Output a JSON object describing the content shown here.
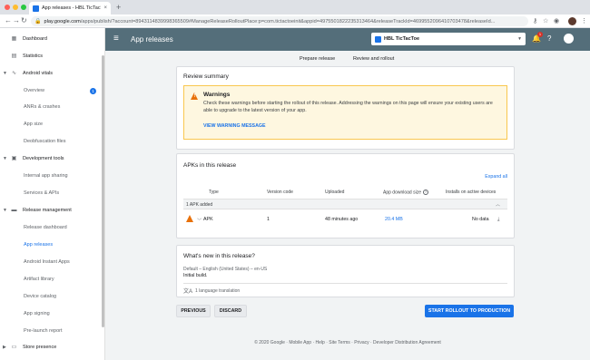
{
  "browser": {
    "tab_title": "App releases - HBL TicTacToe",
    "tab_close": "×",
    "new_tab": "+",
    "url_host": "play.google.com",
    "url_path": "/apps/publish/?account=8943114839998365509#ManageReleaseRolloutPlace:p=com.tictactoeinit&appid=4975501822235313464&releaseTrackId=4699552096410703478&releaseId...",
    "colors": {
      "close": "#ff5f57",
      "minimize": "#febc2e",
      "maximize": "#28c840"
    }
  },
  "sidebar": {
    "items": [
      {
        "label": "Dashboard",
        "icon": "dashboard-icon",
        "level": "top"
      },
      {
        "label": "Statistics",
        "icon": "statistics-icon",
        "level": "top"
      },
      {
        "label": "Android vitals",
        "icon": "vitals-icon",
        "level": "top",
        "expanded": true
      },
      {
        "label": "Overview",
        "level": "sub",
        "badge": "1"
      },
      {
        "label": "ANRs & crashes",
        "level": "sub"
      },
      {
        "label": "App size",
        "level": "sub"
      },
      {
        "label": "Deobfuscation files",
        "level": "sub"
      },
      {
        "label": "Development tools",
        "icon": "devtools-icon",
        "level": "top",
        "expanded": true
      },
      {
        "label": "Internal app sharing",
        "level": "sub"
      },
      {
        "label": "Services & APIs",
        "level": "sub"
      },
      {
        "label": "Release management",
        "icon": "release-icon",
        "level": "top",
        "expanded": true
      },
      {
        "label": "Release dashboard",
        "level": "sub"
      },
      {
        "label": "App releases",
        "level": "sub",
        "active": true
      },
      {
        "label": "Android Instant Apps",
        "level": "sub"
      },
      {
        "label": "Artifact library",
        "level": "sub"
      },
      {
        "label": "Device catalog",
        "level": "sub"
      },
      {
        "label": "App signing",
        "level": "sub"
      },
      {
        "label": "Pre-launch report",
        "level": "sub"
      },
      {
        "label": "Store presence",
        "icon": "store-icon",
        "level": "top",
        "expanded": false
      }
    ]
  },
  "header": {
    "title": "App releases",
    "app_name": "HBL TicTacToe",
    "notification_count": "1",
    "accent": "#546e7a"
  },
  "steps": {
    "prepare": "Prepare release",
    "review": "Review and rollout"
  },
  "review_summary": {
    "title": "Review summary",
    "warning_heading": "Warnings",
    "warning_text": "Check these warnings before starting the rollout of this release. Addressing the warnings on this page will ensure your existing users are able to upgrade to the latest version of your app.",
    "warning_link": "VIEW WARNING MESSAGE"
  },
  "apks": {
    "title": "APKs in this release",
    "expand_all": "Expand all",
    "columns": [
      "Type",
      "Version code",
      "Uploaded",
      "App download size",
      "Installs on active devices"
    ],
    "added_label": "1 APK added",
    "rows": [
      {
        "type": "APK",
        "version_code": "1",
        "uploaded": "48 minutes ago",
        "size": "20.4 MB",
        "installs": "No data"
      }
    ]
  },
  "whats_new": {
    "title": "What's new in this release?",
    "locale": "Default – English (United States) – en-US",
    "text": "Initial build.",
    "translations": "1 language translation"
  },
  "actions": {
    "previous": "PREVIOUS",
    "discard": "DISCARD",
    "start_rollout": "START ROLLOUT TO PRODUCTION"
  },
  "footer": "© 2020 Google · Mobile App · Help · Site Terms · Privacy · Developer Distribution Agreement"
}
